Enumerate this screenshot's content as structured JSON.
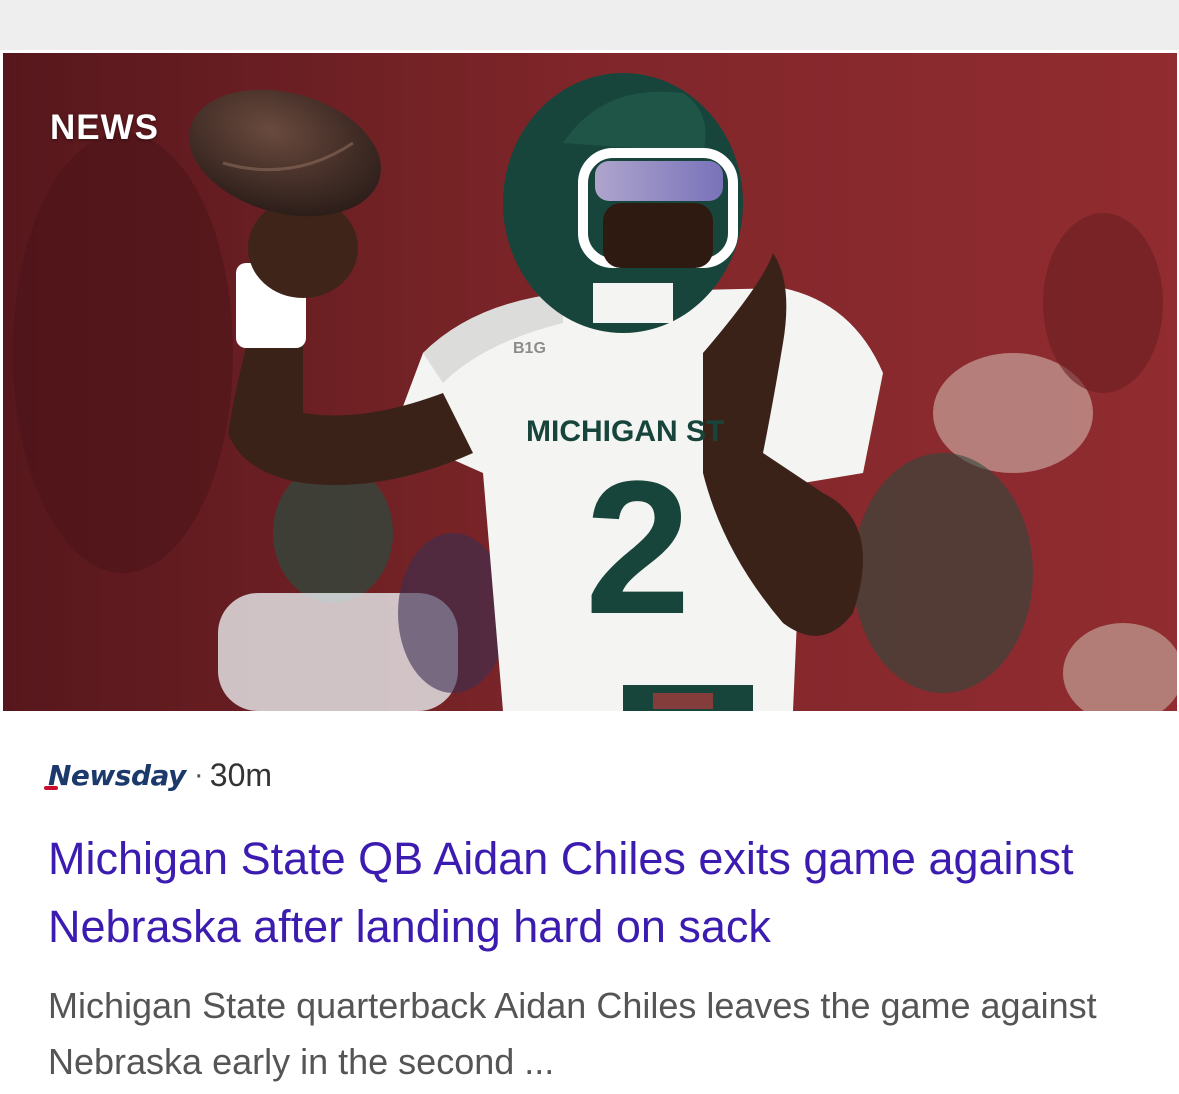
{
  "article": {
    "category_label": "NEWS",
    "source": "Newsday",
    "separator": "·",
    "time_ago": "30m",
    "headline": "Michigan State QB Aidan Chiles exits game against Nebraska after landing hard on sack",
    "snippet": "Michigan State quarterback Aidan Chiles leaves the game against Nebraska early in the second ...",
    "image_jersey_text": "MICHIGAN ST",
    "image_jersey_number": "2",
    "image_patch_text": "B1G"
  },
  "colors": {
    "headline": "#3c1cb0",
    "snippet": "#555555",
    "source_logo": "#1b3a6b",
    "logo_accent": "#c8102e",
    "team_green": "#18453b",
    "stadium_red": "#8b2a2e"
  },
  "icons": {
    "source_logo": "newsday-logo",
    "hero": "football-player-photo"
  }
}
